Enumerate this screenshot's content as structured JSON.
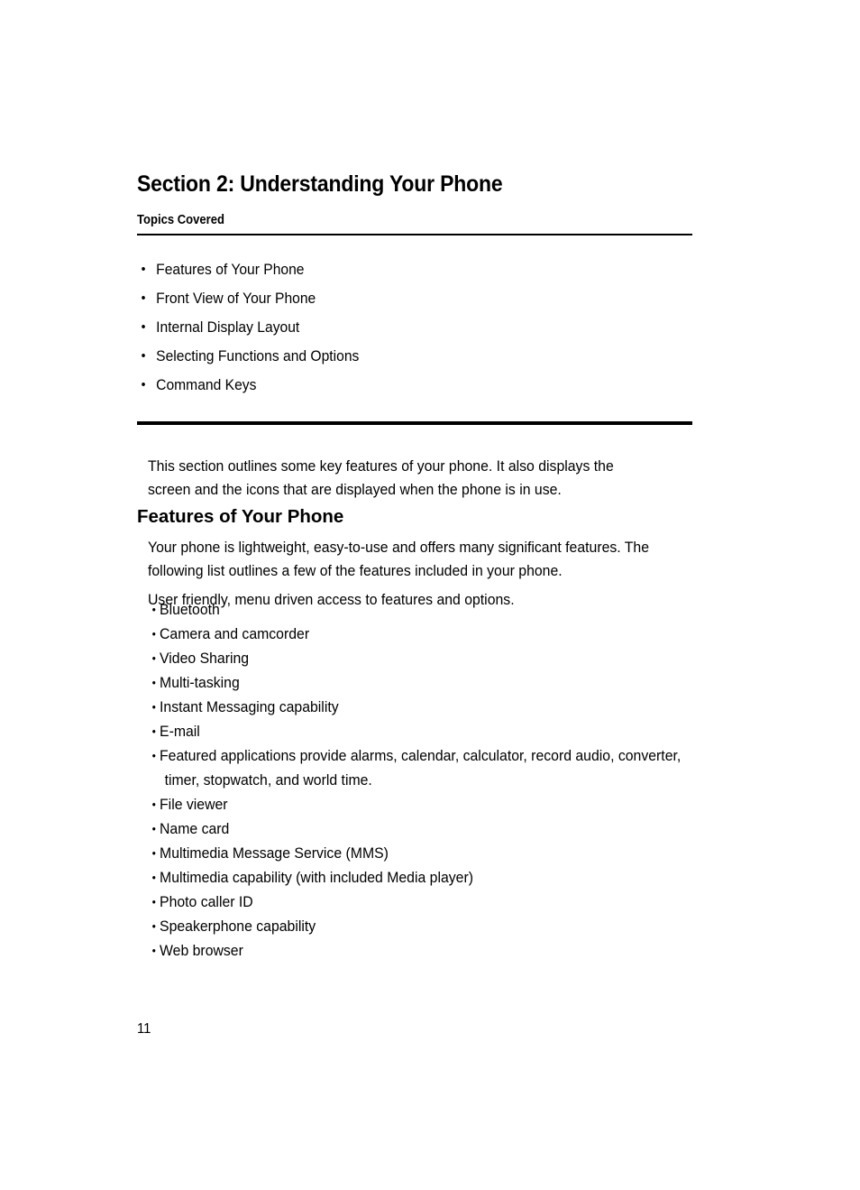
{
  "document": {
    "section_title": "Section 2: Understanding Your Phone",
    "topics_label": "Topics Covered",
    "page_number": "11",
    "bullet_glyph": "•"
  },
  "topics": [
    {
      "label": "Features of Your Phone"
    },
    {
      "label": "Front View of Your Phone"
    },
    {
      "label": "Internal Display Layout"
    },
    {
      "label": "Selecting Functions and Options"
    },
    {
      "label": "Command Keys"
    }
  ],
  "intro": {
    "paragraph": "This section outlines some key features of your phone. It also displays the screen and the icons that are displayed when the phone is in use."
  },
  "features": {
    "heading": "Features of Your Phone",
    "paragraph_1": "Your phone is lightweight, easy-to-use and offers many significant features. The following list outlines a few of the features included in your phone.",
    "paragraph_2": "User friendly, menu driven access to features and options.",
    "items": [
      {
        "text": "Bluetooth",
        "cont": ""
      },
      {
        "text": "Camera and camcorder",
        "cont": ""
      },
      {
        "text": "Video Sharing",
        "cont": ""
      },
      {
        "text": "Multi-tasking",
        "cont": ""
      },
      {
        "text": "Instant Messaging capability",
        "cont": ""
      },
      {
        "text": "E-mail",
        "cont": ""
      },
      {
        "text": "Featured applications provide alarms, calendar, calculator, record audio, converter,",
        "cont": "timer, stopwatch, and world time."
      },
      {
        "text": "File viewer",
        "cont": ""
      },
      {
        "text": "Name card",
        "cont": ""
      },
      {
        "text": "Multimedia Message Service (MMS)",
        "cont": ""
      },
      {
        "text": "Multimedia capability (with included Media player)",
        "cont": ""
      },
      {
        "text": "Photo caller ID",
        "cont": ""
      },
      {
        "text": "Speakerphone capability",
        "cont": ""
      },
      {
        "text": "Web browser",
        "cont": ""
      }
    ]
  }
}
